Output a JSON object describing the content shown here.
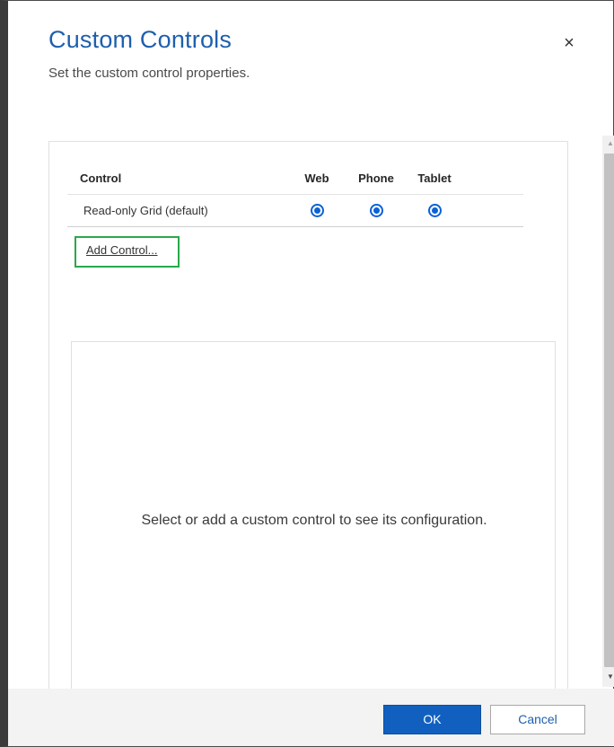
{
  "dialog": {
    "title": "Custom Controls",
    "subtitle": "Set the custom control properties.",
    "close_icon": "close-icon",
    "close_glyph": "×"
  },
  "controls_table": {
    "headers": {
      "control": "Control",
      "web": "Web",
      "phone": "Phone",
      "tablet": "Tablet"
    },
    "rows": [
      {
        "name": "Read-only Grid (default)",
        "web": true,
        "phone": true,
        "tablet": true
      }
    ]
  },
  "add_control": {
    "label": "Add Control..."
  },
  "config_panel": {
    "message": "Select or add a custom control to see its configuration."
  },
  "footer": {
    "ok_label": "OK",
    "cancel_label": "Cancel"
  },
  "colors": {
    "title": "#1e5fae",
    "primary_button": "#1160c0",
    "radio_selected": "#0a62d6",
    "highlight_border": "#2aa84a"
  }
}
